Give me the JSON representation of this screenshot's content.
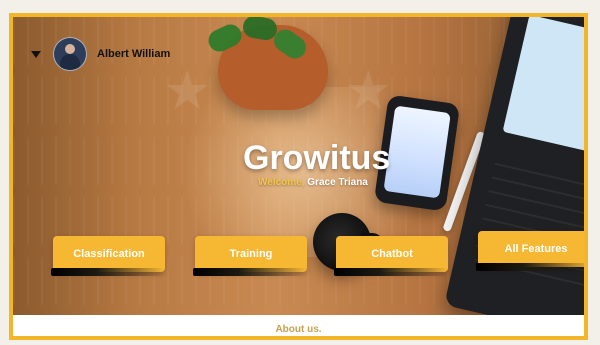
{
  "app": {
    "title": "Growitus",
    "welcome": {
      "prefix": "Welcome,",
      "name": "Grace Triana"
    }
  },
  "user": {
    "name": "Albert William",
    "avatar_icon": "user-avatar-icon"
  },
  "menu": {
    "dropdown_icon": "chevron-down-icon"
  },
  "features": [
    {
      "label": "Classification"
    },
    {
      "label": "Training"
    },
    {
      "label": "Chatbot"
    },
    {
      "label": "All Features"
    }
  ],
  "footer": {
    "about_label": "About us."
  },
  "colors": {
    "accent": "#f6b733",
    "frame": "#f3b52a",
    "welcome_highlight": "#f3c54b",
    "footer_text": "#c6a04d"
  }
}
